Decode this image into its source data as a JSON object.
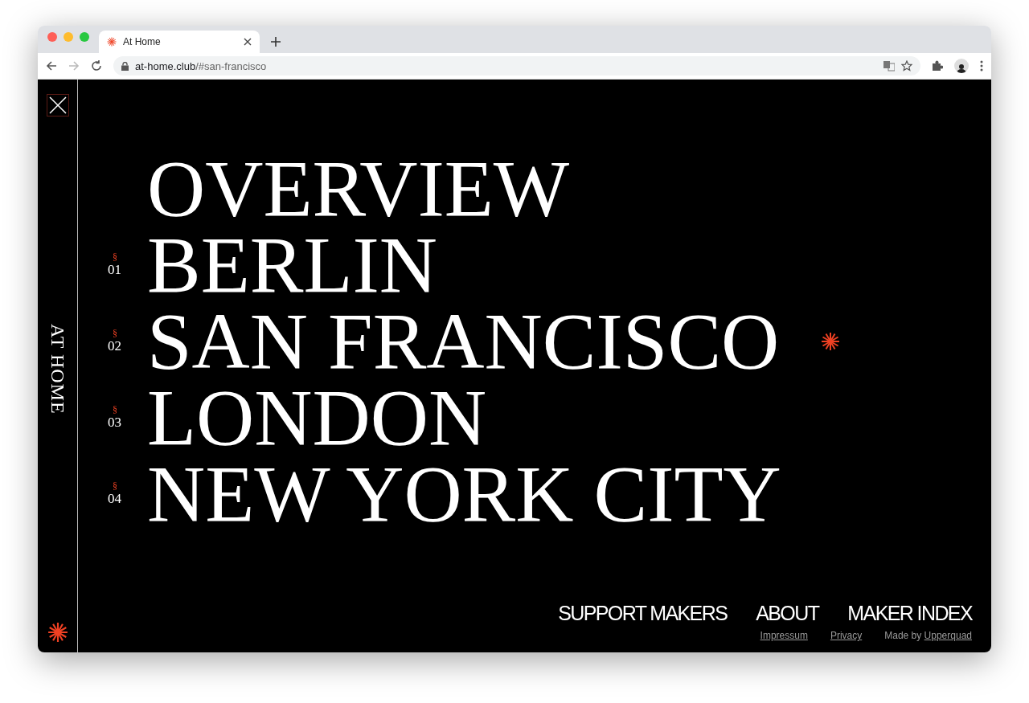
{
  "browser": {
    "tab_title": "At Home",
    "url_host": "at-home.club",
    "url_path": "/#san-francisco"
  },
  "sidebar": {
    "title": "AT HOME"
  },
  "menu": [
    {
      "label": "OVERVIEW",
      "selected": false
    },
    {
      "mark": "§",
      "number": "01",
      "label": "BERLIN",
      "selected": false
    },
    {
      "mark": "§",
      "number": "02",
      "label": "SAN FRANCISCO",
      "selected": true
    },
    {
      "mark": "§",
      "number": "03",
      "label": "LONDON",
      "selected": false
    },
    {
      "mark": "§",
      "number": "04",
      "label": "NEW YORK CITY",
      "selected": false
    }
  ],
  "nav": [
    "SUPPORT MAKERS",
    "ABOUT",
    "MAKER INDEX"
  ],
  "footer_links": [
    "Impressum",
    "Privacy"
  ],
  "credit": {
    "prefix": "Made by",
    "link": "Upperquad"
  }
}
